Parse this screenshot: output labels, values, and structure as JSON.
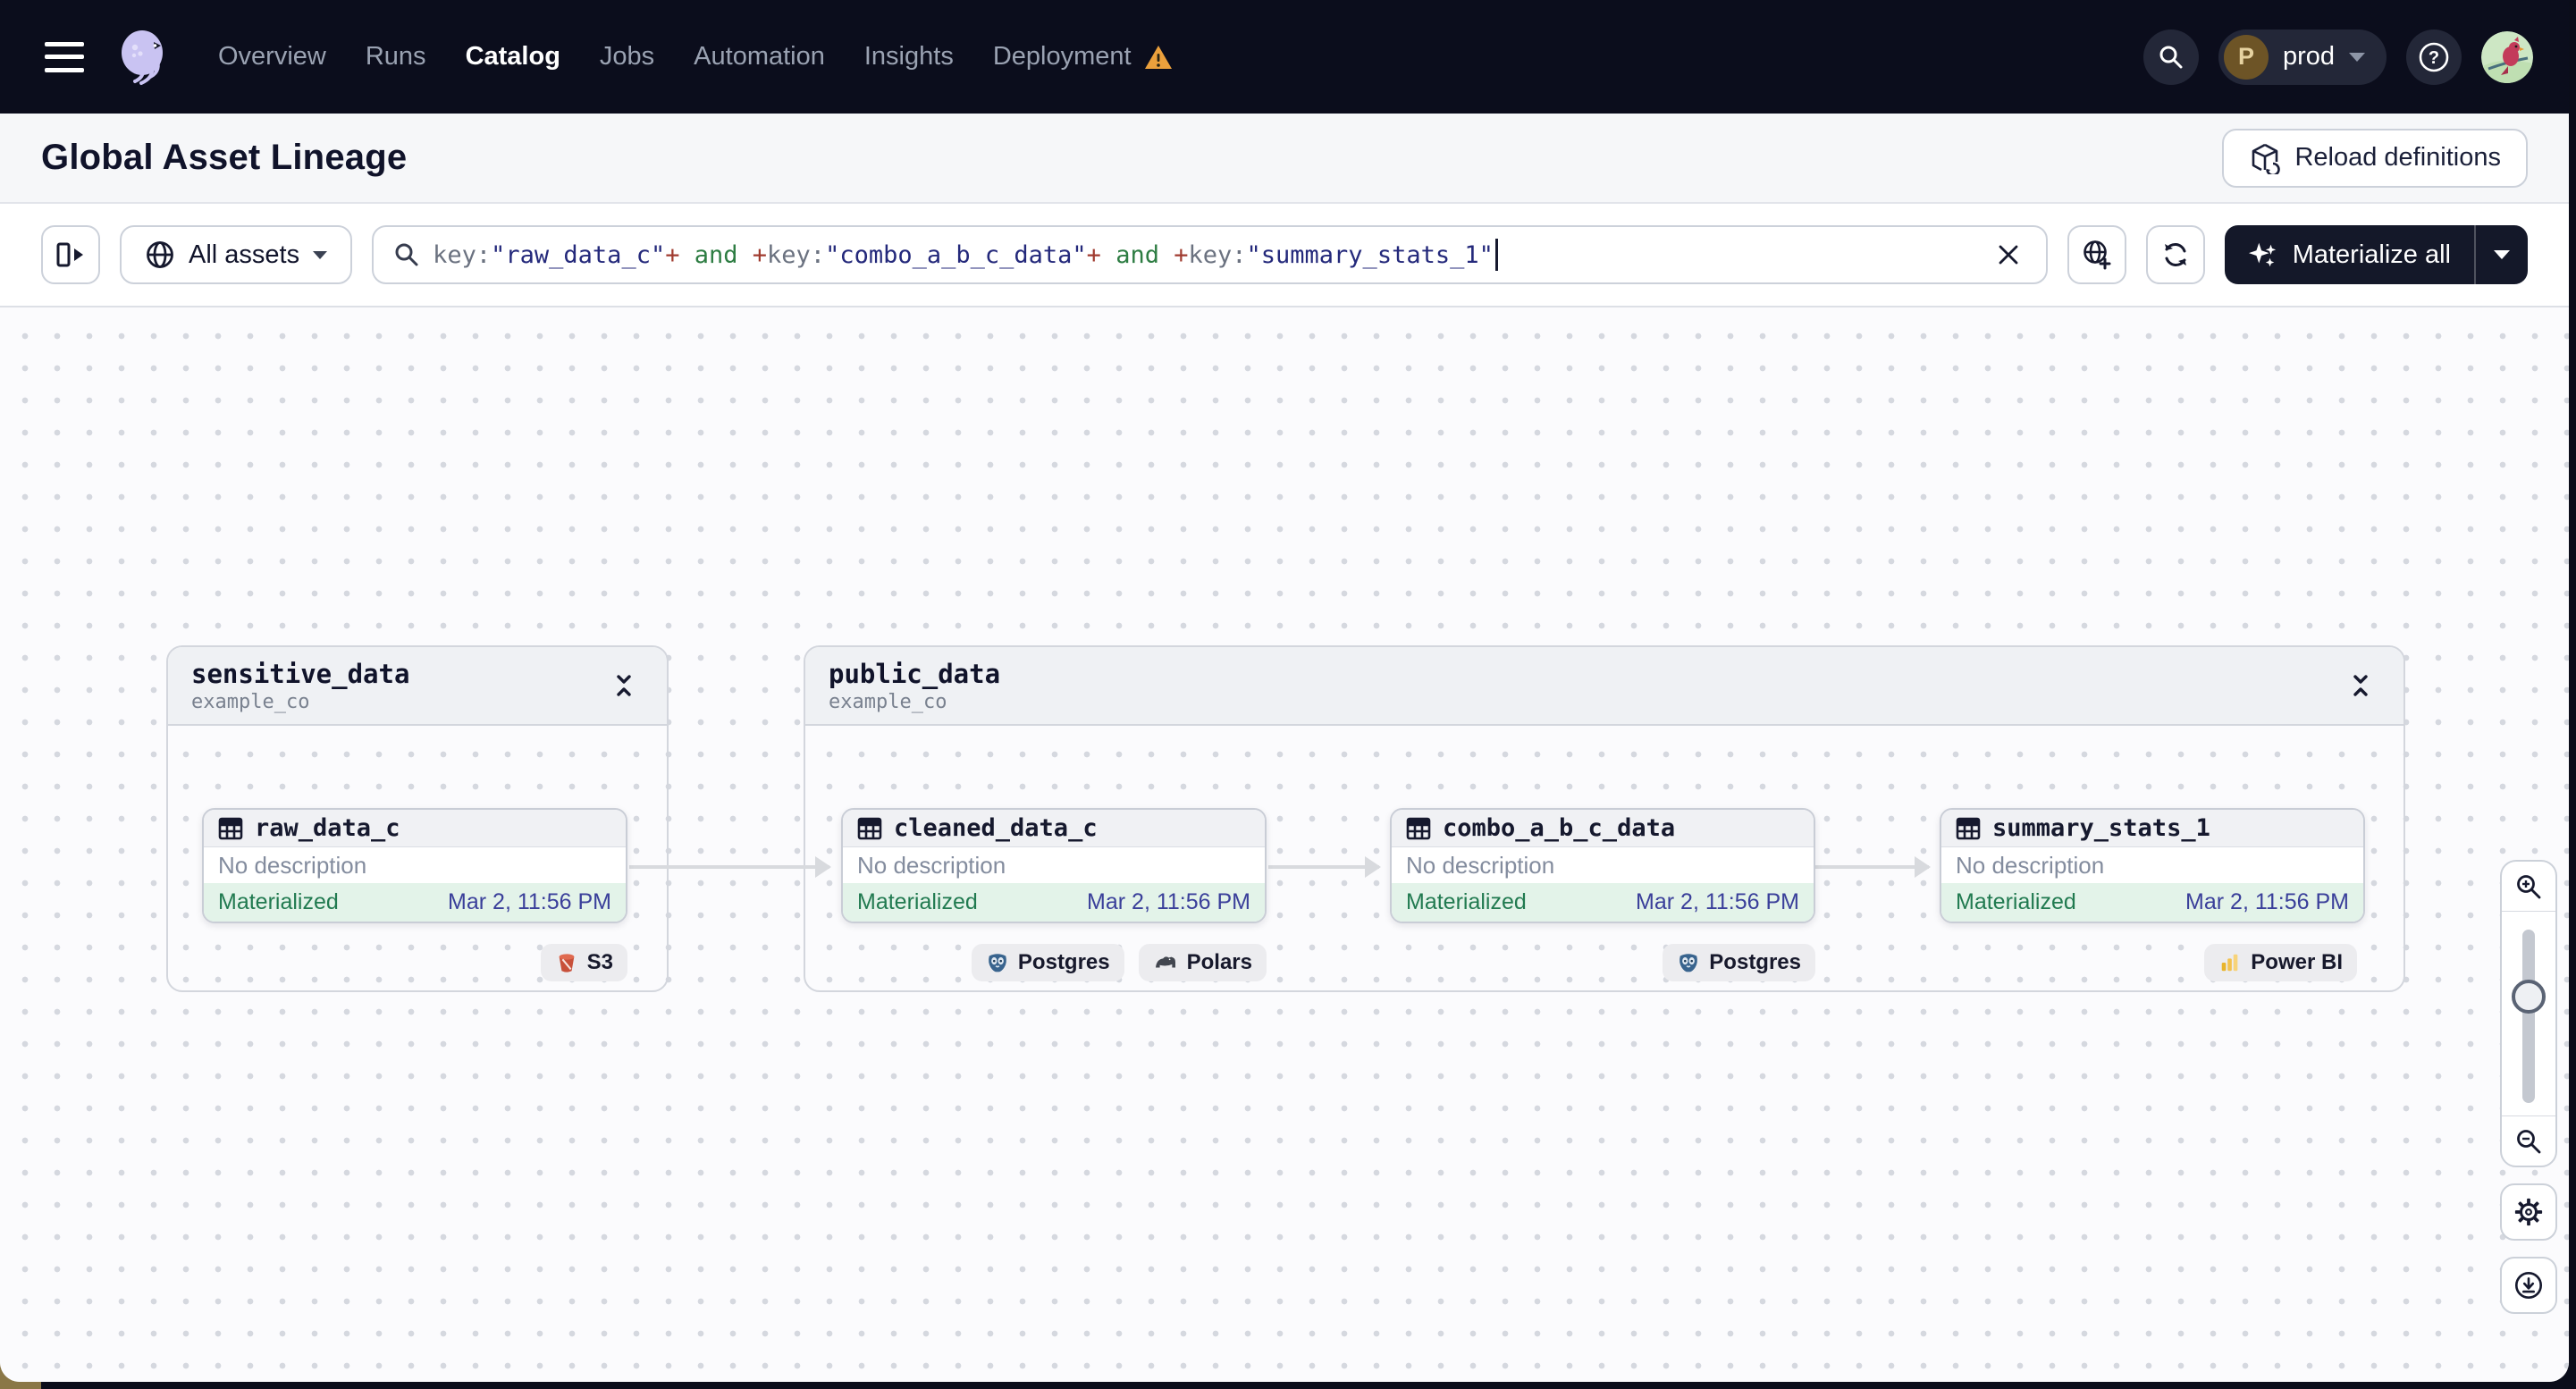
{
  "nav": {
    "items": [
      {
        "label": "Overview",
        "active": false
      },
      {
        "label": "Runs",
        "active": false
      },
      {
        "label": "Catalog",
        "active": true
      },
      {
        "label": "Jobs",
        "active": false
      },
      {
        "label": "Automation",
        "active": false
      },
      {
        "label": "Insights",
        "active": false
      },
      {
        "label": "Deployment",
        "active": false,
        "warning": true
      }
    ],
    "environment": {
      "label": "prod",
      "avatar_letter": "P"
    }
  },
  "header": {
    "title": "Global Asset Lineage",
    "reload_button_label": "Reload definitions"
  },
  "toolbar": {
    "asset_filter_label": "All assets",
    "materialize_label": "Materialize all",
    "search": {
      "segments": [
        {
          "text": "key:",
          "type": "attr"
        },
        {
          "text": "\"raw_data_c\"",
          "type": "value"
        },
        {
          "text": "+",
          "type": "plus"
        },
        {
          "text": " and ",
          "type": "bool"
        },
        {
          "text": "+",
          "type": "plus"
        },
        {
          "text": "key:",
          "type": "attr"
        },
        {
          "text": "\"combo_a_b_c_data\"",
          "type": "value"
        },
        {
          "text": "+",
          "type": "plus"
        },
        {
          "text": " and ",
          "type": "bool"
        },
        {
          "text": "+",
          "type": "plus"
        },
        {
          "text": "key:",
          "type": "attr"
        },
        {
          "text": "\"summary_stats_1\"",
          "type": "value"
        }
      ]
    }
  },
  "graph": {
    "groups": [
      {
        "name": "sensitive_data",
        "repo": "example_co"
      },
      {
        "name": "public_data",
        "repo": "example_co"
      }
    ],
    "nodes": [
      {
        "title": "raw_data_c",
        "description": "No description",
        "status": "Materialized",
        "timestamp": "Mar 2, 11:56 PM",
        "badges": [
          {
            "label": "S3",
            "icon": "s3-icon"
          }
        ]
      },
      {
        "title": "cleaned_data_c",
        "description": "No description",
        "status": "Materialized",
        "timestamp": "Mar 2, 11:56 PM",
        "badges": [
          {
            "label": "Postgres",
            "icon": "postgres-icon"
          },
          {
            "label": "Polars",
            "icon": "polars-icon"
          }
        ]
      },
      {
        "title": "combo_a_b_c_data",
        "description": "No description",
        "status": "Materialized",
        "timestamp": "Mar 2, 11:56 PM",
        "badges": [
          {
            "label": "Postgres",
            "icon": "postgres-icon"
          }
        ]
      },
      {
        "title": "summary_stats_1",
        "description": "No description",
        "status": "Materialized",
        "timestamp": "Mar 2, 11:56 PM",
        "badges": [
          {
            "label": "Power BI",
            "icon": "powerbi-icon"
          }
        ]
      }
    ]
  },
  "colors": {
    "nav_bg": "#0b0d1c",
    "accent_dark_button": "#141829",
    "query_attr": "#6b7280",
    "query_value": "#24297b",
    "query_plus": "#a03b2f",
    "query_bool": "#2e7d43",
    "status_green": "#217a50",
    "timestamp_indigo": "#3a3f9a",
    "status_bg": "#e3f3e9",
    "warning_orange": "#eba03c",
    "s3_red": "#c8503a",
    "postgres_blue": "#39648e",
    "powerbi_yellow": "#e8b42c"
  },
  "icons": [
    "menu-icon",
    "dagster-logo-icon",
    "warning-icon",
    "search-icon",
    "help-icon",
    "reload-definitions-icon",
    "panel-toggle-icon",
    "globe-icon",
    "globe-add-icon",
    "refresh-icon",
    "sparkle-icon",
    "table-icon",
    "collapse-icon",
    "s3-icon",
    "postgres-icon",
    "polars-icon",
    "powerbi-icon",
    "zoom-in-icon",
    "zoom-out-icon",
    "gear-icon",
    "download-icon"
  ]
}
